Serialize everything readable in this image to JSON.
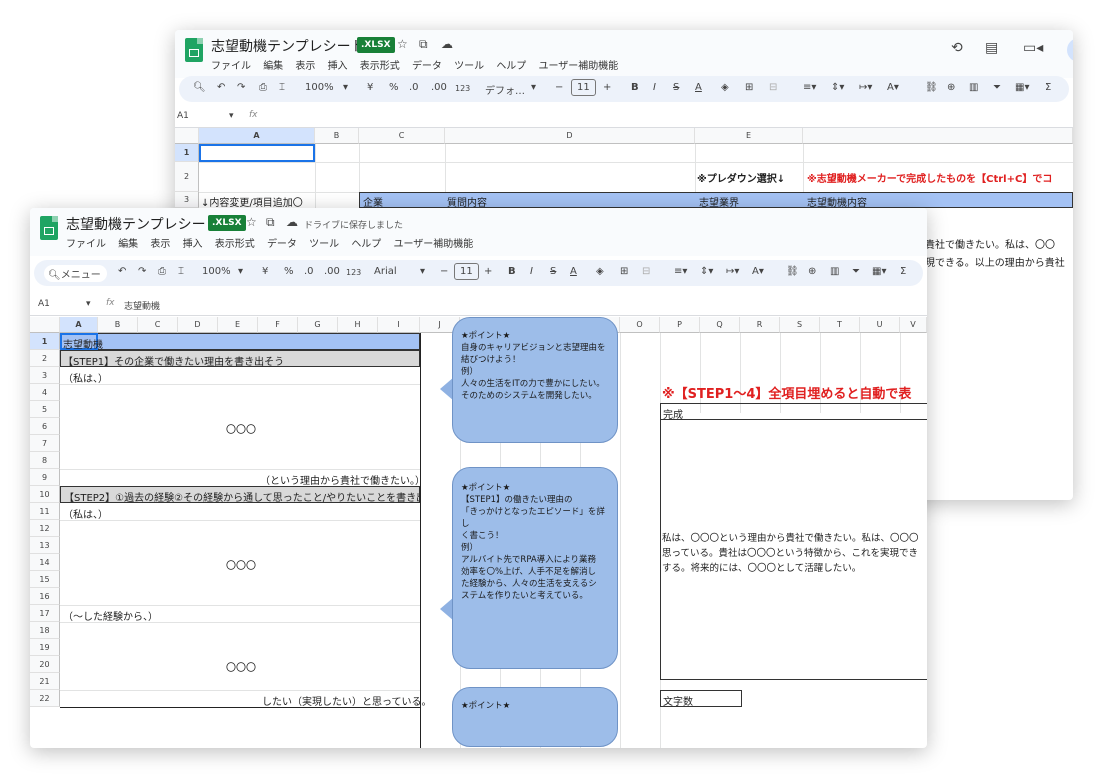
{
  "back": {
    "title": "志望動機テンプレシート",
    "badge": ".XLSX",
    "menus": [
      "ファイル",
      "編集",
      "表示",
      "挿入",
      "表示形式",
      "データ",
      "ツール",
      "ヘルプ",
      "ユーザー補助機能"
    ],
    "toolbar": {
      "zoom": "100%",
      "currency": "¥",
      "percent": "%",
      "dec_minus": ".0",
      "dec_plus": ".00",
      "fmt123": "123",
      "font": "デフォ…",
      "size": "11"
    },
    "cell_ref": "A1",
    "fx": "fx",
    "columns": [
      "A",
      "B",
      "C",
      "D",
      "E"
    ],
    "rows": [
      "1",
      "2",
      "3"
    ],
    "cells": {
      "e2": "※プレダウン選択↓",
      "f2": "※志望動機メーカーで完成したものを【Ctrl+C】でコ",
      "a3": "↓内容変更/項目追加〇",
      "c3": "企業",
      "d3": "質問内容",
      "e3": "志望業界",
      "f3": "志望動機内容",
      "f4": "ら貴社で働きたい。私は、〇〇",
      "f5": "実現できる。以上の理由から貴社"
    }
  },
  "front": {
    "title": "志望動機テンプレシート",
    "badge": ".XLSX",
    "saved": "ドライブに保存しました",
    "menus": [
      "ファイル",
      "編集",
      "表示",
      "挿入",
      "表示形式",
      "データ",
      "ツール",
      "ヘルプ",
      "ユーザー補助機能"
    ],
    "toolbar": {
      "menu": "メニュー",
      "zoom": "100%",
      "currency": "¥",
      "percent": "%",
      "dec_minus": ".0",
      "dec_plus": ".00",
      "fmt123": "123",
      "font": "Arial",
      "size": "11"
    },
    "cell_ref": "A1",
    "fx": "fx",
    "formula": "志望動機",
    "columns": [
      "A",
      "B",
      "C",
      "D",
      "E",
      "F",
      "G",
      "H",
      "I",
      "J",
      "K",
      "L",
      "M",
      "N",
      "O",
      "P",
      "Q",
      "R",
      "S",
      "T",
      "U",
      "V"
    ],
    "rows": [
      "1",
      "2",
      "3",
      "4",
      "5",
      "6",
      "7",
      "8",
      "9",
      "10",
      "11",
      "12",
      "13",
      "14",
      "15",
      "16",
      "17",
      "18",
      "19",
      "20",
      "21",
      "22"
    ],
    "cells": {
      "a1": "志望動機",
      "a2": "【STEP1】その企業で働きたい理由を書き出そう",
      "a3": "（私は、）",
      "e6": "〇〇〇",
      "i9": "（という理由から貴社で働きたい。）",
      "a10": "【STEP2】①過去の経験②その経験から通して思ったこと/やりたいことを書き出そ",
      "a11": "（私は、）",
      "e14": "〇〇〇",
      "a17": "（～した経験から、）",
      "e20": "〇〇〇",
      "i22": "したい（実現したい）と思っている。",
      "p5": "※【STEP1～4】全項目埋めると自動で表",
      "p6": "完成",
      "p14a": "私は、〇〇〇という理由から貴社で働きたい。私は、〇〇〇",
      "p14b": "思っている。貴社は〇〇〇という特徴から、これを実現でき",
      "p14c": "する。将来的には、〇〇〇として活躍したい。",
      "p22": "文字数"
    },
    "bubbles": [
      {
        "lines": [
          "★ポイント★",
          "自身のキャリアビジョンと志望理由を",
          "結びつけよう！",
          "例）",
          "人々の生活をITの力で豊かにしたい。",
          "そのためのシステムを開発したい。"
        ]
      },
      {
        "lines": [
          "★ポイント★",
          "【STEP1】の働きたい理由の",
          "「きっかけとなったエピソード」を詳し",
          "く書こう！",
          "例）",
          "アルバイト先でRPA導入により業務",
          "効率を〇%上げ、人手不足を解消し",
          "た経験から、人々の生活を支えるシ",
          "ステムを作りたいと考えている。"
        ]
      },
      {
        "lines": [
          "★ポイント★"
        ]
      }
    ]
  }
}
